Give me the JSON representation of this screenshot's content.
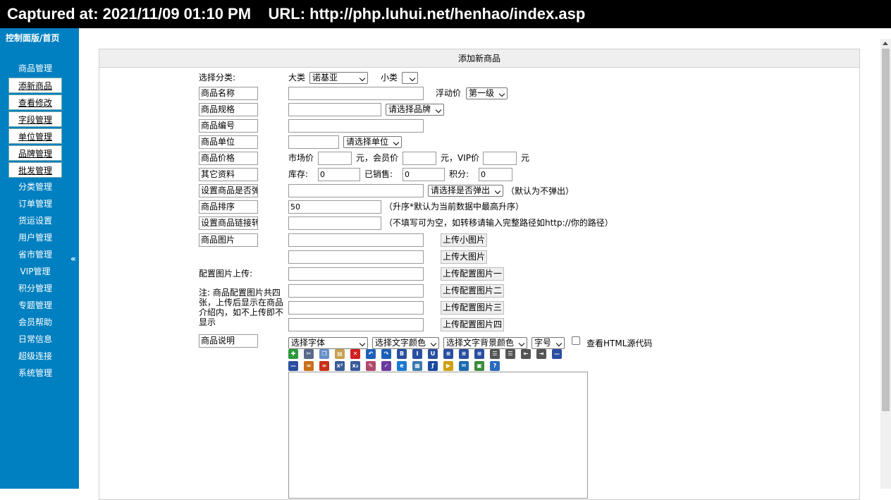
{
  "capture": {
    "text": "Captured at: 2021/11/09 01:10 PM    URL: http://php.luhui.net/henhao/index.asp"
  },
  "sidebar": {
    "title": "控制面版/首页",
    "items": [
      {
        "label": "商品管理",
        "boxed": false
      },
      {
        "label": "添新商品",
        "boxed": true
      },
      {
        "label": "查看修改",
        "boxed": true
      },
      {
        "label": "字段管理",
        "boxed": true
      },
      {
        "label": "单位管理",
        "boxed": true
      },
      {
        "label": "品牌管理",
        "boxed": true
      },
      {
        "label": "批发管理",
        "boxed": true
      },
      {
        "label": "分类管理",
        "boxed": false
      },
      {
        "label": "订单管理",
        "boxed": false
      },
      {
        "label": "货运设置",
        "boxed": false
      },
      {
        "label": "用户管理",
        "boxed": false
      },
      {
        "label": "省市管理",
        "boxed": false
      },
      {
        "label": "VIP管理",
        "boxed": false
      },
      {
        "label": "积分管理",
        "boxed": false
      },
      {
        "label": "专题管理",
        "boxed": false
      },
      {
        "label": "会员帮助",
        "boxed": false
      },
      {
        "label": "日常信息",
        "boxed": false
      },
      {
        "label": "超级连接",
        "boxed": false
      },
      {
        "label": "系统管理",
        "boxed": false
      }
    ],
    "collapse_glyph": "«"
  },
  "panel": {
    "title": "添加新商品"
  },
  "form": {
    "category": {
      "label": "选择分类:",
      "major_label": "大类",
      "major_value": "诺基亚",
      "minor_label": "小类",
      "minor_value": ""
    },
    "name": {
      "label": "商品名称",
      "value": "",
      "float_label": "浮动价",
      "float_value": "第一级"
    },
    "spec": {
      "label": "商品规格",
      "value": "",
      "brand_value": "请选择品牌"
    },
    "code": {
      "label": "商品编号",
      "value": ""
    },
    "unit": {
      "label": "商品单位",
      "value": "",
      "unit_value": "请选择单位"
    },
    "price": {
      "label": "商品价格",
      "market_label": "市场价",
      "market_value": "",
      "yuan1": "元，会员价",
      "member_value": "",
      "yuan2": "元，VIP价",
      "vip_value": "",
      "yuan3": "元"
    },
    "other": {
      "label": "其它资料",
      "stock_label": "库存:",
      "stock_value": "0",
      "sold_label": "已销售:",
      "sold_value": "0",
      "points_label": "积分:",
      "points_value": "0"
    },
    "popup": {
      "label": "设置商品是否弹出",
      "value": "",
      "select_value": "请选择是否弹出",
      "hint": "（默认为不弹出）"
    },
    "sort": {
      "label": "商品排序",
      "value": "50",
      "hint": "（升序*默认为当前数据中最高升序）"
    },
    "link": {
      "label": "设置商品链接转向",
      "value": "",
      "hint": "（不填写可为空，如转移请输入完整路径如http://你的路径）"
    },
    "image": {
      "label": "商品图片",
      "small_value": "",
      "small_button": "上传小图片",
      "big_value": "",
      "big_button": "上传大图片"
    },
    "config": {
      "label": "配置图片上传:",
      "note": "注: 商品配置图片共四张，上传后显示在商品介绍内，如不上传即不显示",
      "buttons": [
        "上传配置图片一",
        "上传配置图片二",
        "上传配置图片三",
        "上传配置图片四"
      ]
    },
    "desc": {
      "label": "商品说明",
      "font_value": "选择字体",
      "color_value": "选择文字颜色",
      "bgcolor_value": "选择文字背景颜色",
      "size_value": "字号",
      "html_label": "查看HTML源代码"
    }
  },
  "toolbar": {
    "row1": [
      {
        "name": "new-doc-icon",
        "bg": "#2e9a3c",
        "glyph": "✚"
      },
      {
        "name": "cut-icon",
        "bg": "#5a6a8a",
        "glyph": "✂"
      },
      {
        "name": "copy-icon",
        "bg": "#6a8fc8",
        "glyph": "❐"
      },
      {
        "name": "paste-icon",
        "bg": "#c8a050",
        "glyph": "▤"
      },
      {
        "name": "delete-icon",
        "bg": "#d02020",
        "glyph": "✕"
      },
      {
        "name": "undo-icon",
        "bg": "#1e60b8",
        "glyph": "↶"
      },
      {
        "name": "redo-icon",
        "bg": "#1e60b8",
        "glyph": "↷"
      },
      {
        "name": "bold-icon",
        "bg": "#2a4fa0",
        "glyph": "B"
      },
      {
        "name": "italic-icon",
        "bg": "#2a4fa0",
        "glyph": "I"
      },
      {
        "name": "underline-icon",
        "bg": "#2a4fa0",
        "glyph": "U"
      },
      {
        "name": "align-left-icon",
        "bg": "#2a4fa0",
        "glyph": "≡"
      },
      {
        "name": "align-center-icon",
        "bg": "#2a4fa0",
        "glyph": "≡"
      },
      {
        "name": "align-right-icon",
        "bg": "#2a4fa0",
        "glyph": "≡"
      },
      {
        "name": "ordered-list-icon",
        "bg": "#555",
        "glyph": "☰"
      },
      {
        "name": "unordered-list-icon",
        "bg": "#555",
        "glyph": "☰"
      },
      {
        "name": "outdent-icon",
        "bg": "#555",
        "glyph": "⇤"
      },
      {
        "name": "indent-icon",
        "bg": "#555",
        "glyph": "⇥"
      },
      {
        "name": "horizontal-rule-icon",
        "bg": "#2a4fa0",
        "glyph": "—"
      }
    ],
    "row2": [
      {
        "name": "line-icon",
        "bg": "#2a4fa0",
        "glyph": "—"
      },
      {
        "name": "link-icon",
        "bg": "#c8701a",
        "glyph": "∞"
      },
      {
        "name": "unlink-icon",
        "bg": "#c8301a",
        "glyph": "∞"
      },
      {
        "name": "superscript-icon",
        "bg": "#3a5a9a",
        "glyph": "x²"
      },
      {
        "name": "subscript-icon",
        "bg": "#3a5a9a",
        "glyph": "x₂"
      },
      {
        "name": "eraser-icon",
        "bg": "#b04a6a",
        "glyph": "✎"
      },
      {
        "name": "spellcheck-icon",
        "bg": "#6a3aa0",
        "glyph": "✓"
      },
      {
        "name": "ie-icon",
        "bg": "#1a7ad0",
        "glyph": "e"
      },
      {
        "name": "table-icon",
        "bg": "#3a7ab0",
        "glyph": "▦"
      },
      {
        "name": "flash-icon",
        "bg": "#1a4aa0",
        "glyph": "ƒ"
      },
      {
        "name": "media-icon",
        "bg": "#d0a010",
        "glyph": "▶"
      },
      {
        "name": "comment-icon",
        "bg": "#1a6ab0",
        "glyph": "✉"
      },
      {
        "name": "image-icon",
        "bg": "#3a8a3a",
        "glyph": "▣"
      },
      {
        "name": "help-icon",
        "bg": "#2a6ac0",
        "glyph": "?"
      }
    ]
  }
}
